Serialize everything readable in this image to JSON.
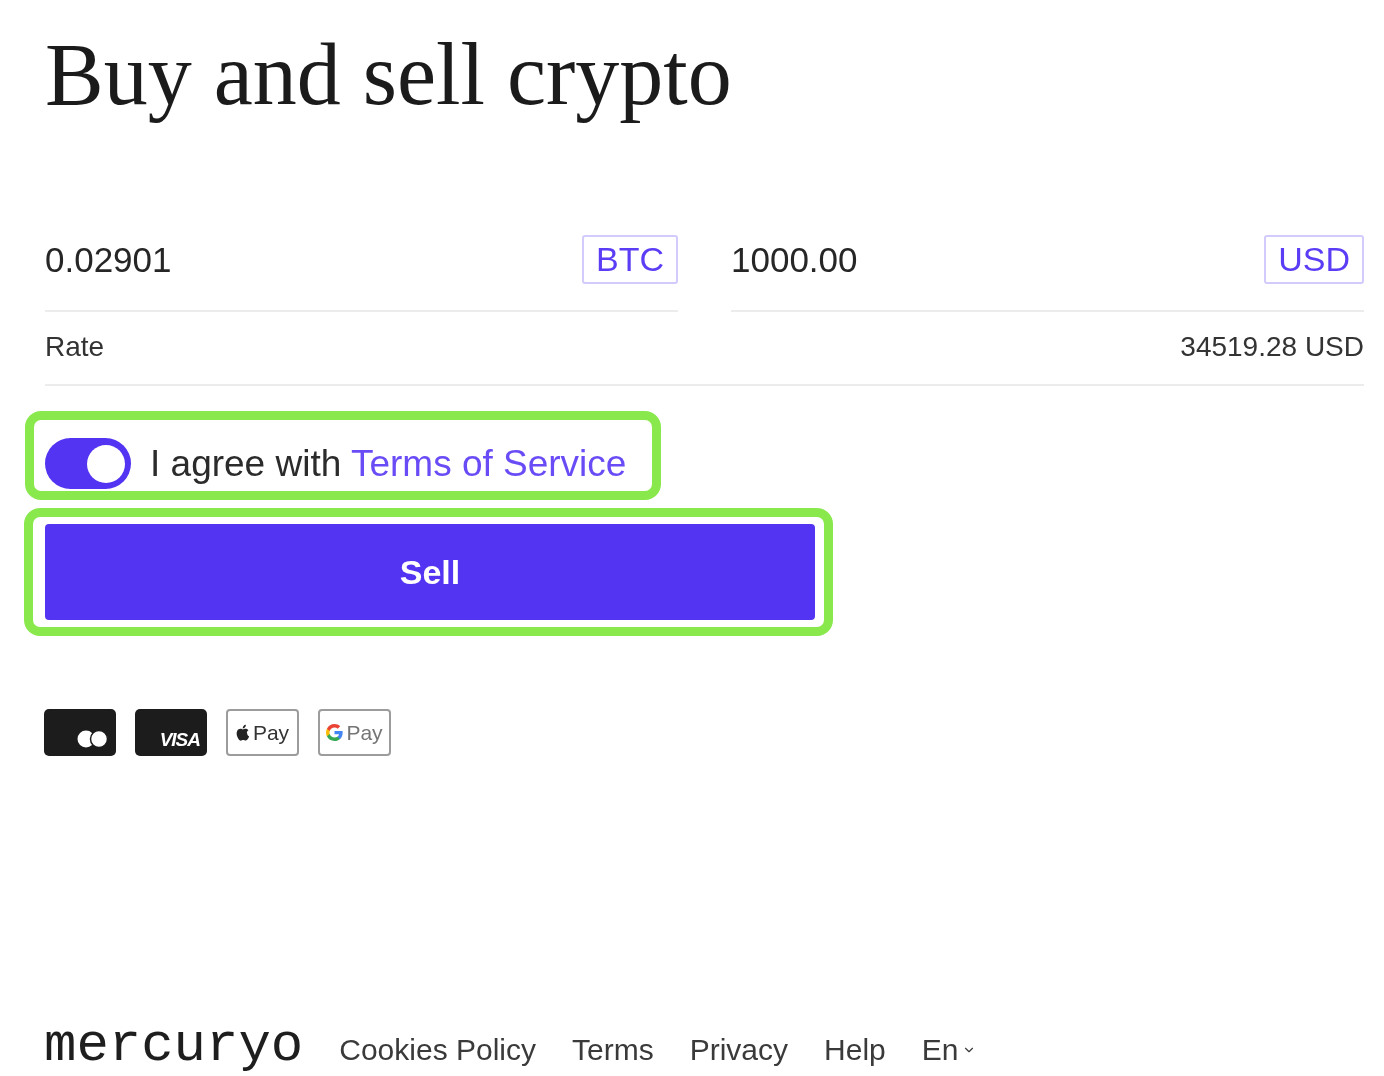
{
  "page_title": "Buy and sell crypto",
  "exchange": {
    "fields": [
      {
        "value": "0.02901",
        "currency": "BTC"
      },
      {
        "value": "1000.00",
        "currency": "USD"
      }
    ],
    "rate": {
      "label": "Rate",
      "value": "34519.28 USD"
    }
  },
  "agreement": {
    "on": true,
    "text": "I agree with",
    "link": "Terms of Service",
    "highlighted": true
  },
  "submit": {
    "label": "Sell",
    "highlighted": true
  },
  "payment_methods": [
    {
      "kind": "mastercard"
    },
    {
      "kind": "visa",
      "label": "VISA"
    },
    {
      "kind": "applepay",
      "label": "Pay"
    },
    {
      "kind": "googlepay",
      "label": "Pay"
    }
  ],
  "footer": {
    "logo": "mercuryo",
    "links": [
      "Cookies Policy",
      "Terms",
      "Privacy",
      "Help"
    ],
    "language": "En"
  }
}
